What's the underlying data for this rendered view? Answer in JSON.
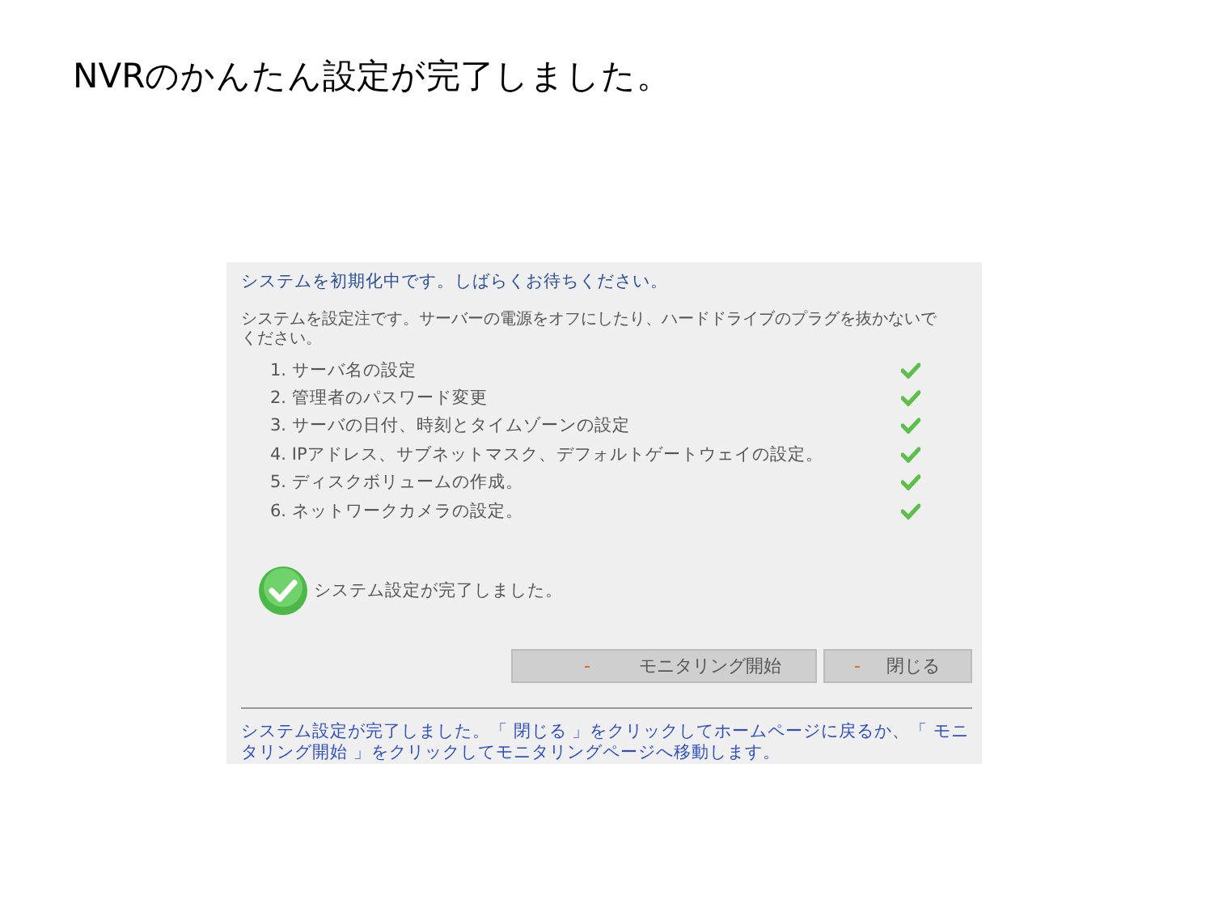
{
  "title": "NVRのかんたん設定が完了しました。",
  "panel": {
    "header": "システムを初期化中です。しばらくお待ちください。",
    "description": "システムを設定注です。サーバーの電源をオフにしたり、ハードドライブのプラグを抜かないでください。",
    "steps": [
      {
        "label": "1. サーバ名の設定",
        "done": true
      },
      {
        "label": "2. 管理者のパスワード変更",
        "done": true
      },
      {
        "label": "3. サーバの日付、時刻とタイムゾーンの設定",
        "done": true
      },
      {
        "label": "4. IPアドレス、サブネットマスク、デフォルトゲートウェイの設定。",
        "done": true
      },
      {
        "label": "5. ディスクボリュームの作成。",
        "done": true
      },
      {
        "label": "6. ネットワークカメラの設定。",
        "done": true
      }
    ],
    "result": "システム設定が完了しました。",
    "buttons": [
      {
        "marker": "-",
        "label": "モニタリング開始"
      },
      {
        "marker": "-",
        "label": "閉じる"
      }
    ],
    "footer": "システム設定が完了しました。「 閉じる 」をクリックしてホームページに戻るか、「 モニタリング開始 」をクリックしてモニタリングページへ移動します。"
  }
}
